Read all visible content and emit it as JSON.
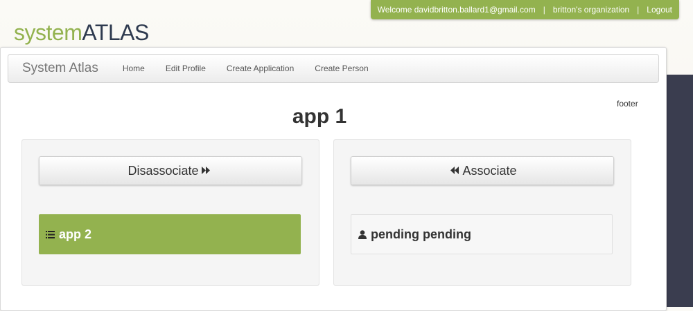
{
  "topbar": {
    "welcome": "Welcome davidbritton.ballard1@gmail.com",
    "org": "britton's organization",
    "logout": "Logout",
    "separator": "|"
  },
  "logo": {
    "part1": "system",
    "part2": "ATLAS"
  },
  "navbar": {
    "brand": "System Atlas",
    "items": [
      {
        "label": "Home"
      },
      {
        "label": "Edit Profile"
      },
      {
        "label": "Create Application"
      },
      {
        "label": "Create Person"
      }
    ]
  },
  "footer": "footer",
  "page": {
    "title": "app 1"
  },
  "left": {
    "button": "Disassociate",
    "button_icon": "fast-forward-icon",
    "item": "app 2",
    "item_icon": "list-icon"
  },
  "right": {
    "button": "Associate",
    "button_icon": "fast-backward-icon",
    "item": "pending pending",
    "item_icon": "user-icon"
  },
  "colors": {
    "accent": "#93b24f",
    "logo_dark": "#2e3a4f",
    "side_band": "#3a3d4f"
  }
}
